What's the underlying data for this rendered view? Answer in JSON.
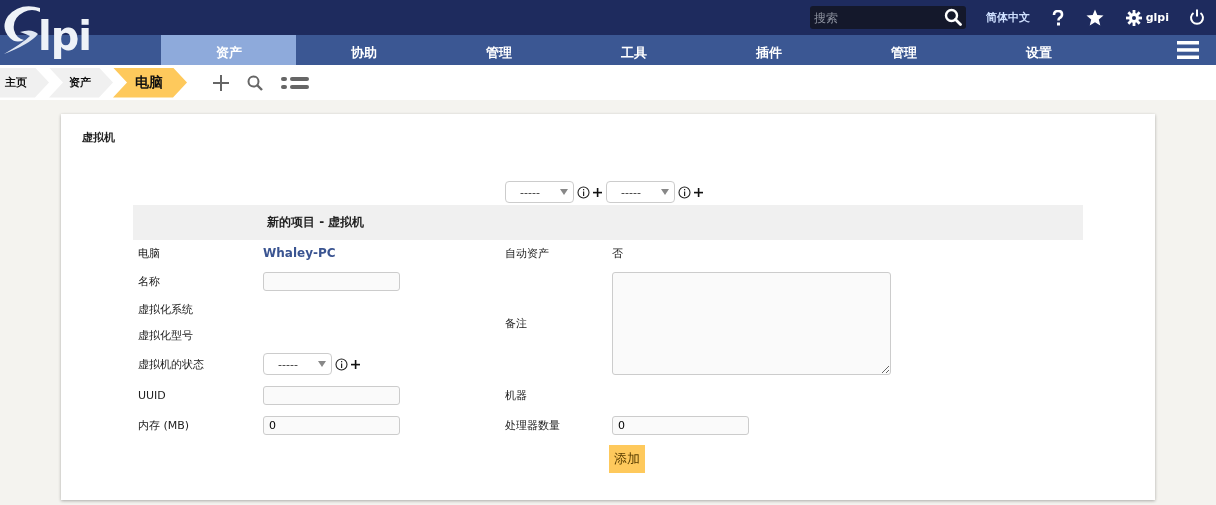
{
  "header": {
    "logo_text": "lpi",
    "search": {
      "placeholder": "搜索"
    },
    "language": "简体中文",
    "user": "glpi"
  },
  "nav": {
    "tabs": [
      {
        "label": "资产",
        "selected": true
      },
      {
        "label": "协助",
        "selected": false
      },
      {
        "label": "管理",
        "selected": false
      },
      {
        "label": "工具",
        "selected": false
      },
      {
        "label": "插件",
        "selected": false
      },
      {
        "label": "管理",
        "selected": false
      },
      {
        "label": "设置",
        "selected": false
      }
    ]
  },
  "breadcrumb": {
    "items": [
      {
        "label": "主页",
        "selected": false
      },
      {
        "label": "资产",
        "selected": false
      },
      {
        "label": "电脑",
        "selected": true
      }
    ]
  },
  "card": {
    "title": "虚拟机",
    "selectors": [
      {
        "value": "-----"
      },
      {
        "value": "-----"
      }
    ],
    "heading": "新的项目 - 虚拟机",
    "rows": [
      {
        "left": {
          "label": "电脑",
          "kind": "link",
          "value": "Whaley-PC"
        },
        "right": {
          "label": "自动资产",
          "kind": "text",
          "value": "否"
        }
      },
      {
        "left": {
          "label": "名称",
          "kind": "input"
        },
        "right": {
          "label": "备注",
          "kind": "textarea"
        }
      },
      {
        "left": {
          "label": "虚拟化系统",
          "kind": "none"
        }
      },
      {
        "left": {
          "label": "虚拟化型号",
          "kind": "none"
        }
      },
      {
        "left": {
          "label": "虚拟机的状态",
          "kind": "select",
          "value": "-----"
        }
      },
      {
        "left": {
          "label": "UUID",
          "kind": "input"
        },
        "right": {
          "label": "机器",
          "kind": "none"
        }
      },
      {
        "left": {
          "label": "内存 (MB)",
          "kind": "input",
          "value": "0"
        },
        "right": {
          "label": "处理器数量",
          "kind": "input",
          "value": "0"
        }
      }
    ],
    "submit": "添加"
  }
}
